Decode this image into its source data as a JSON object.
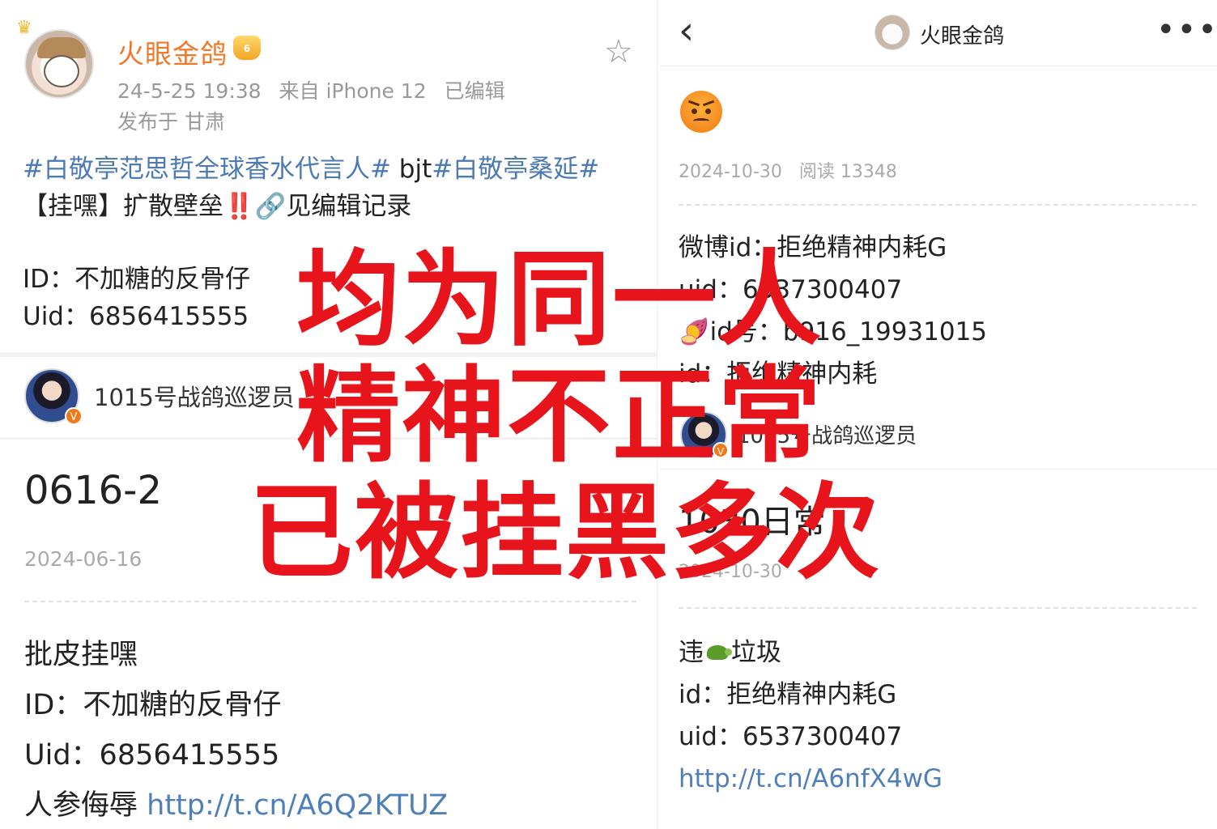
{
  "left_post": {
    "author": "火眼金鸽",
    "vip_badge": "6",
    "meta": {
      "time": "24-5-25 19:38",
      "source": "来自 iPhone 12",
      "edited": "已编辑"
    },
    "location": "发布于 甘肃",
    "tags": "#白敬亭范思哲全球香水代言人#",
    "tag_mid": " bjt",
    "tag2": "#白敬亭桑延#",
    "line2_prefix": "【挂嘿】扩散壁垒",
    "line2_warn": "‼️",
    "line2_link_icon": "🔗",
    "line2_suffix": "见编辑记录",
    "id_line": "ID：不加糖的反骨仔",
    "uid_line": "Uid：6856415555",
    "comment_user": "1015号战鸽巡逻员",
    "article_title": "0616-2",
    "article_date": "2024-06-16",
    "article_line1": "批皮挂嘿",
    "article_line2": "ID：不加糖的反骨仔",
    "article_line3": "Uid：6856415555",
    "article_line4_prefix": "人参侮辱 ",
    "article_line4_link": "http://t.cn/A6Q2KTUZ"
  },
  "right_post": {
    "nav_title": "火眼金鸽",
    "date": "2024-10-30",
    "reads": "阅读 13348",
    "line1": "微博id：拒绝精神内耗G",
    "line2": "uid：6537300407",
    "line3_icon": "🍠",
    "line3": "id号：b916_19931015",
    "line4": "id：拒绝精神内耗",
    "comment_user": "1015号战鸽巡逻员",
    "title": "1030日常",
    "title_date": "2024-10-30",
    "b_line1_a": "违",
    "b_line1_b": "垃圾",
    "b_line2": "id：拒绝精神内耗G",
    "b_line3": "uid：6537300407",
    "b_link": "http://t.cn/A6nfX4wG"
  },
  "overlay": {
    "line1": "均为同一人",
    "line2": "精神不正常",
    "line3": "已被挂黑多次",
    "color": "#e8141b"
  },
  "icons": {
    "star": "star-icon",
    "back": "chevron-left-icon",
    "more": "more-icon"
  }
}
